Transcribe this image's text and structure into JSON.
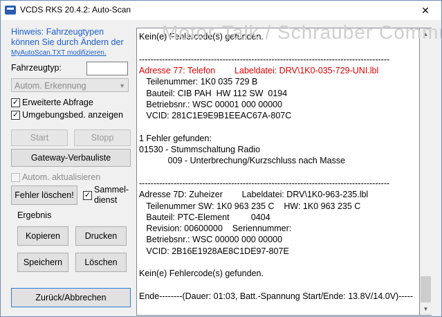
{
  "window": {
    "title": "VCDS RKS 20.4.2:  Auto-Scan",
    "close_glyph": "✕"
  },
  "left": {
    "hint_line1": "Hinweis: Fahrzeugtypen",
    "hint_line2": "können Sie durch Ändern der",
    "hint_link": "MyAutoScan.TXT modifizieren.",
    "vehicle_type_label": "Fahrzeugtyp:",
    "vehicle_type_value": "",
    "detection_combo": "Autom. Erkennung",
    "extended_query": {
      "label": "Erweiterte Abfrage",
      "checked": true
    },
    "ambient_display": {
      "label": "Umgebungsbed. anzeigen",
      "checked": true
    },
    "start_label": "Start",
    "stop_label": "Stopp",
    "gateway_label": "Gateway-Verbauliste",
    "auto_update": {
      "label": "Autom. aktualisieren",
      "checked": false
    },
    "clear_faults_label": "Fehler löschen!",
    "collective_service": {
      "line1": "Sammel-",
      "line2": "dienst",
      "checked": true
    },
    "result_group_label": "Ergebnis",
    "copy_label": "Kopieren",
    "print_label": "Drucken",
    "save_label": "Speichern",
    "delete_label": "Löschen",
    "back_label": "Zurück/Abbrechen",
    "check_glyph": "✓"
  },
  "log": {
    "lines": [
      {
        "text": "Kein(e) Fehlercode(s) gefunden.",
        "color": "black"
      },
      {
        "text": "",
        "color": "black"
      },
      {
        "text": "---------------------------------------------------------------------------------------",
        "color": "black"
      },
      {
        "text": "Adresse 77: Telefon        Labeldatei: DRV\\1K0-035-729-UNI.lbl",
        "color": "red"
      },
      {
        "text": "   Teilenummer: 1K0 035 729 B",
        "color": "black"
      },
      {
        "text": "   Bauteil: CIB PAH  HW 112 SW  0194",
        "color": "black"
      },
      {
        "text": "   Betriebsnr.: WSC 00001 000 00000",
        "color": "black"
      },
      {
        "text": "   VCID: 281C1E9E9B1EEAC67A-807C",
        "color": "black"
      },
      {
        "text": "",
        "color": "black"
      },
      {
        "text": "1 Fehler gefunden:",
        "color": "black"
      },
      {
        "text": "01530 - Stummschaltung Radio",
        "color": "black"
      },
      {
        "text": "            009 - Unterbrechung/Kurzschluss nach Masse",
        "color": "black"
      },
      {
        "text": "",
        "color": "black"
      },
      {
        "text": "---------------------------------------------------------------------------------------",
        "color": "black"
      },
      {
        "text": "Adresse 7D: Zuheizer        Labeldatei: DRV\\1K0-963-235.lbl",
        "color": "black"
      },
      {
        "text": "   Teilenummer SW: 1K0 963 235 C    HW: 1K0 963 235 C",
        "color": "black"
      },
      {
        "text": "   Bauteil: PTC-Element         0404",
        "color": "black"
      },
      {
        "text": "   Revision: 00600000    Seriennummer:",
        "color": "black"
      },
      {
        "text": "   Betriebsnr.: WSC 00000 000 00000",
        "color": "black"
      },
      {
        "text": "   VCID: 2B16E1928AE8C1DE97-807E",
        "color": "black"
      },
      {
        "text": "",
        "color": "black"
      },
      {
        "text": "Kein(e) Fehlercode(s) gefunden.",
        "color": "black"
      },
      {
        "text": "",
        "color": "black"
      },
      {
        "text": "Ende--------(Dauer: 01:03, Batt.-Spannung Start/Ende: 13.8V/14.0V)-----",
        "color": "black"
      }
    ]
  },
  "scrollbar": {
    "up_glyph": "▲",
    "down_glyph": "▼"
  },
  "watermark": "Motor-Talk / Schrauber Community"
}
